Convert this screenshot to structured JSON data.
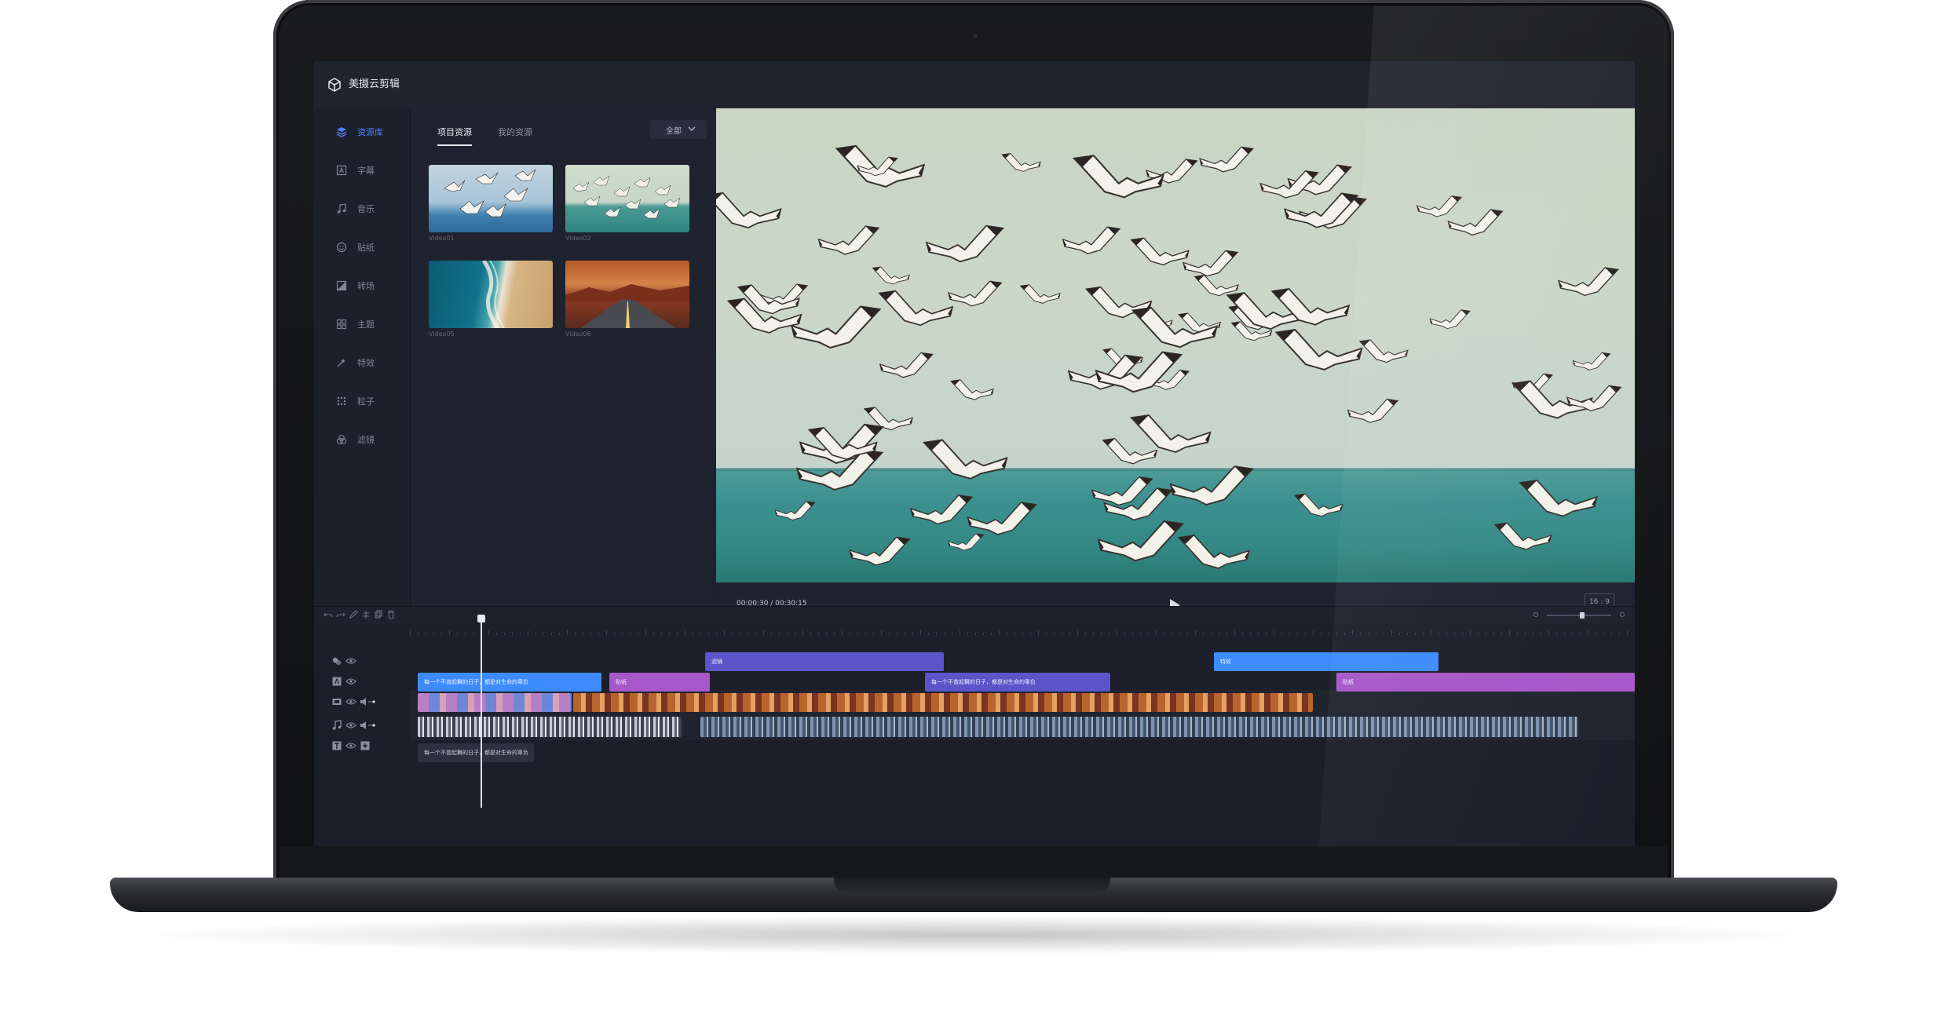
{
  "app": {
    "title": "美摄云剪辑"
  },
  "sidebar": {
    "items": [
      {
        "label": "资源库",
        "icon": "library-icon",
        "active": true
      },
      {
        "label": "字幕",
        "icon": "caption-icon"
      },
      {
        "label": "音乐",
        "icon": "music-icon"
      },
      {
        "label": "贴纸",
        "icon": "sticker-icon"
      },
      {
        "label": "转场",
        "icon": "transition-icon"
      },
      {
        "label": "主题",
        "icon": "theme-icon"
      },
      {
        "label": "特效",
        "icon": "effects-icon"
      },
      {
        "label": "粒子",
        "icon": "particle-icon"
      },
      {
        "label": "滤镜",
        "icon": "filter-icon"
      }
    ]
  },
  "resources": {
    "tabs": [
      {
        "label": "项目资源",
        "active": true
      },
      {
        "label": "我的资源"
      }
    ],
    "filter": {
      "selected": "全部"
    },
    "items": [
      {
        "label": "Video01"
      },
      {
        "label": "Video02"
      },
      {
        "label": "Video05"
      },
      {
        "label": "Video06"
      }
    ]
  },
  "player": {
    "timecode": "00:00:30 / 00:30:15",
    "aspect_ratio": "16 : 9"
  },
  "timeline": {
    "clips": {
      "effect_a": "滤镜",
      "effect_b": "特效",
      "caption_a": "每一个不曾起舞的日子，都是对生命的辜负",
      "sticker_a": "贴纸",
      "caption_b": "每一个不曾起舞的日子，都是对生命的辜负",
      "sticker_b": "贴纸",
      "text_a": "每一个不曾起舞的日子，都是对生命的辜负"
    },
    "zoom_level": 0.5
  },
  "colors": {
    "accent": "#4e7cff",
    "clip_blue": "#3d8bff",
    "clip_indigo": "#5b55c9",
    "clip_purple": "#a657c8",
    "bg": "#1e2230"
  }
}
